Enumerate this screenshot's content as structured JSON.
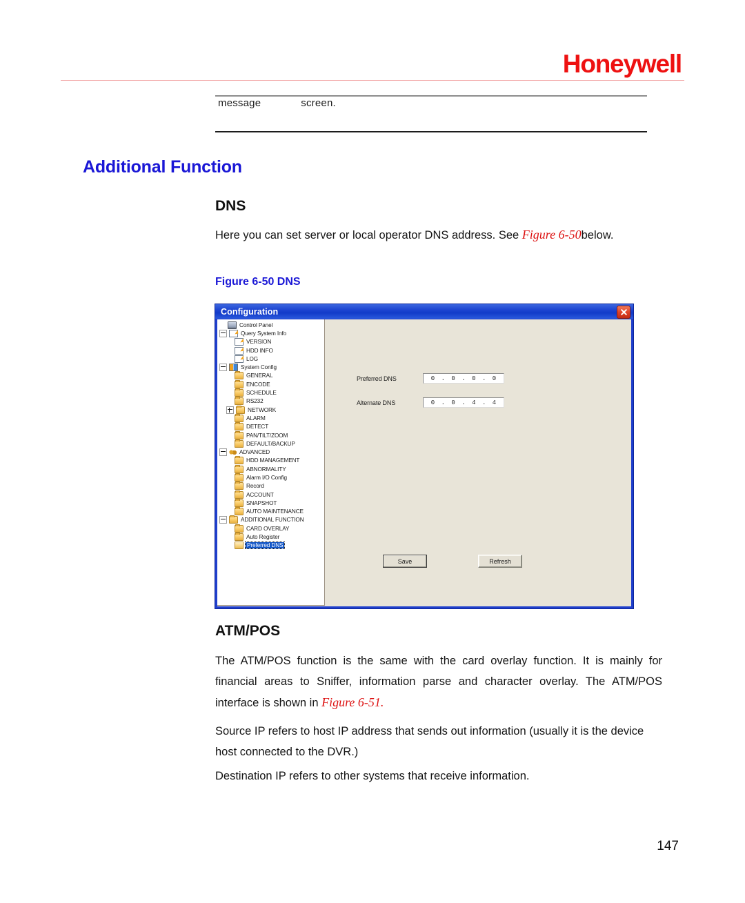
{
  "header": {
    "brand": "Honeywell"
  },
  "note": {
    "word1": "message",
    "word2": "screen."
  },
  "headings": {
    "section": "Additional Function",
    "dns": "DNS",
    "atmpos": "ATM/POS"
  },
  "paragraphs": {
    "dns_intro_a": "Here you can set server or local operator DNS address. See ",
    "dns_intro_fig": "Figure 6-50",
    "dns_intro_b": "below.",
    "figure_caption": "Figure 6-50 DNS",
    "atmpos_a": "The ATM/POS function is the same with the card overlay function. It is mainly for financial areas to Sniffer, information parse and character overlay. The ATM/POS interface is shown in ",
    "atmpos_fig": "Figure 6-51.",
    "source_ip": "Source IP refers to host IP address that sends out information (usually it is the device host connected to the DVR.)",
    "destination_ip": "Destination IP refers to other systems that receive information."
  },
  "page_number": "147",
  "dialog": {
    "title": "Configuration",
    "close_icon": "close-icon",
    "tree": [
      {
        "label": "Control Panel",
        "indent": 0,
        "expander": "none",
        "icon": "monitor-icon"
      },
      {
        "label": "Query System Info",
        "indent": 0,
        "expander": "minus",
        "icon": "note-icon"
      },
      {
        "label": "VERSION",
        "indent": 1,
        "expander": "none",
        "icon": "note-icon"
      },
      {
        "label": "HDD INFO",
        "indent": 1,
        "expander": "none",
        "icon": "note-icon"
      },
      {
        "label": "LOG",
        "indent": 1,
        "expander": "none",
        "icon": "note-icon"
      },
      {
        "label": "System Config",
        "indent": 0,
        "expander": "minus",
        "icon": "sysconfig-icon"
      },
      {
        "label": "GENERAL",
        "indent": 1,
        "expander": "none",
        "icon": "folder-icon"
      },
      {
        "label": "ENCODE",
        "indent": 1,
        "expander": "none",
        "icon": "folder-icon"
      },
      {
        "label": "SCHEDULE",
        "indent": 1,
        "expander": "none",
        "icon": "folder-icon"
      },
      {
        "label": "RS232",
        "indent": 1,
        "expander": "none",
        "icon": "folder-icon"
      },
      {
        "label": "NETWORK",
        "indent": 1,
        "expander": "plus",
        "icon": "folder-icon"
      },
      {
        "label": "ALARM",
        "indent": 1,
        "expander": "none",
        "icon": "folder-icon"
      },
      {
        "label": "DETECT",
        "indent": 1,
        "expander": "none",
        "icon": "folder-icon"
      },
      {
        "label": "PAN/TILT/ZOOM",
        "indent": 1,
        "expander": "none",
        "icon": "folder-icon"
      },
      {
        "label": "DEFAULT/BACKUP",
        "indent": 1,
        "expander": "none",
        "icon": "folder-icon"
      },
      {
        "label": "ADVANCED",
        "indent": 0,
        "expander": "minus",
        "icon": "gears-icon"
      },
      {
        "label": "HDD MANAGEMENT",
        "indent": 1,
        "expander": "none",
        "icon": "folder-icon"
      },
      {
        "label": "ABNORMALITY",
        "indent": 1,
        "expander": "none",
        "icon": "folder-icon"
      },
      {
        "label": "Alarm I/O Config",
        "indent": 1,
        "expander": "none",
        "icon": "folder-icon"
      },
      {
        "label": "Record",
        "indent": 1,
        "expander": "none",
        "icon": "folder-icon"
      },
      {
        "label": "ACCOUNT",
        "indent": 1,
        "expander": "none",
        "icon": "folder-icon"
      },
      {
        "label": "SNAPSHOT",
        "indent": 1,
        "expander": "none",
        "icon": "folder-icon"
      },
      {
        "label": "AUTO MAINTENANCE",
        "indent": 1,
        "expander": "none",
        "icon": "folder-icon"
      },
      {
        "label": "ADDITIONAL FUNCTION",
        "indent": 0,
        "expander": "minus",
        "icon": "folder-icon"
      },
      {
        "label": "CARD OVERLAY",
        "indent": 1,
        "expander": "none",
        "icon": "folder-icon"
      },
      {
        "label": "Auto Register",
        "indent": 1,
        "expander": "none",
        "icon": "folder-icon"
      },
      {
        "label": "Preferred DNS",
        "indent": 1,
        "expander": "none",
        "icon": "folder-open-icon",
        "selected": true
      }
    ],
    "fields": [
      {
        "label": "Preferred DNS",
        "octets": [
          "0",
          "0",
          "0",
          "0"
        ]
      },
      {
        "label": "Alternate DNS",
        "octets": [
          "0",
          "0",
          "4",
          "4"
        ]
      }
    ],
    "buttons": {
      "save": "Save",
      "refresh": "Refresh"
    }
  },
  "colors": {
    "brand_red": "#ee1111",
    "heading_blue": "#1a17d6",
    "figref_red": "#dd1111",
    "titlebar_blue": "#1b42cf",
    "dialog_face": "#e8e4d8",
    "selection_blue": "#1256c8"
  }
}
